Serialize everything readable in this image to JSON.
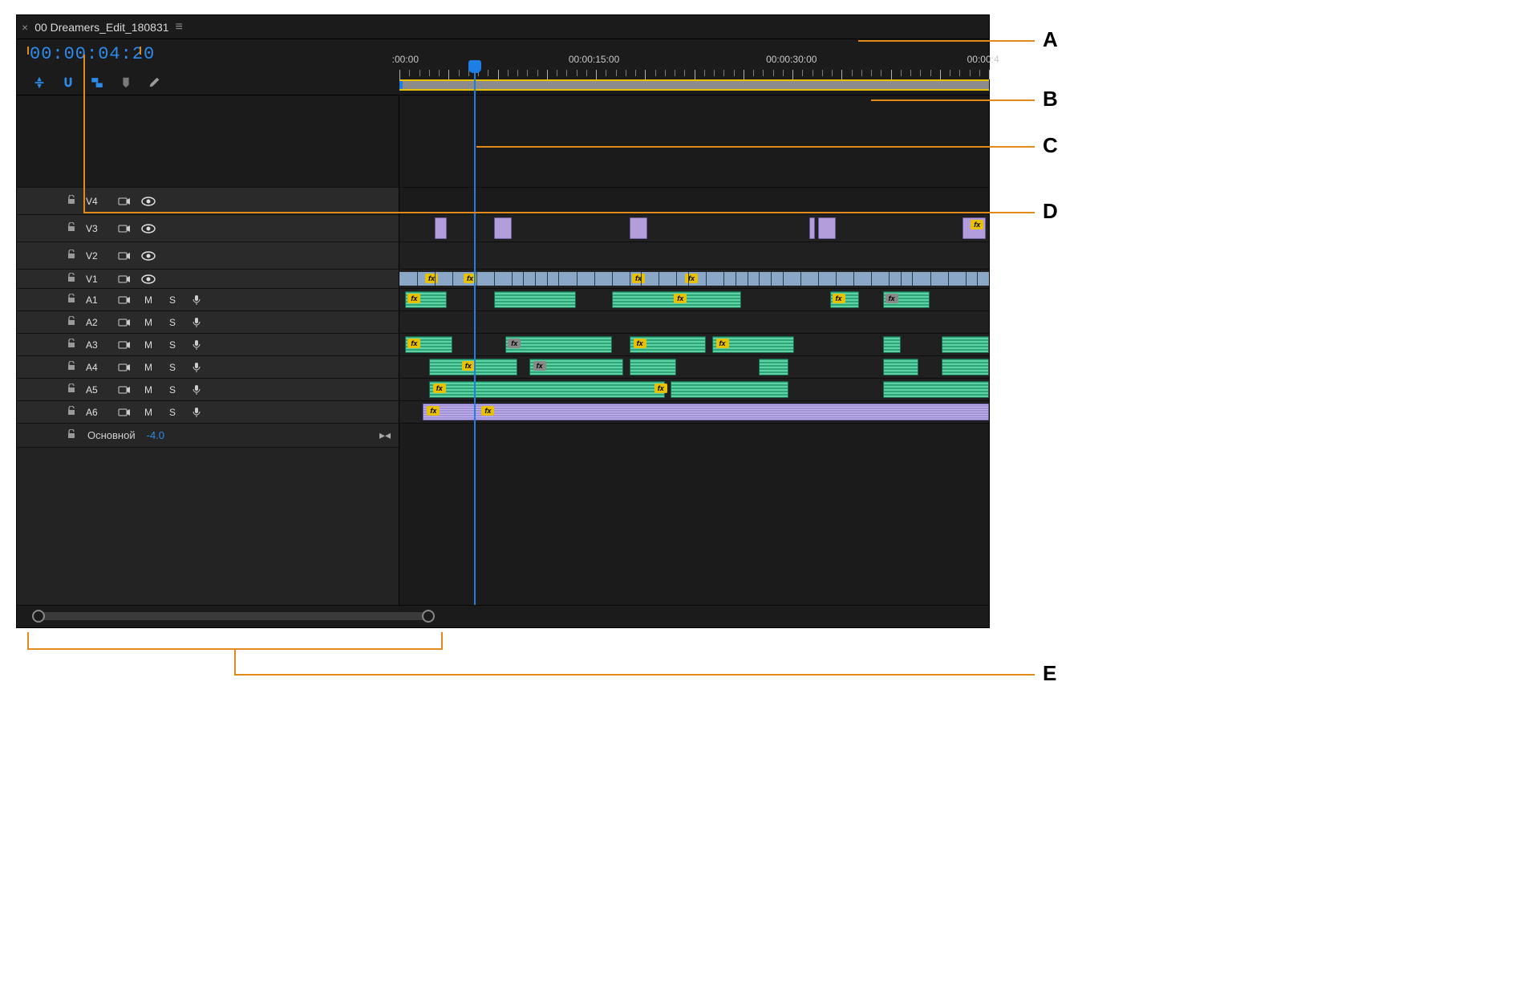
{
  "tab": {
    "title": "00 Dreamers_Edit_180831"
  },
  "timecode": "00:00:04:20",
  "ruler": {
    "labels": [
      ":00:00",
      "00:00:15:00",
      "00:00:30:00",
      "00:00:4"
    ],
    "label_positions_pct": [
      1.0,
      33.0,
      66.5,
      100.0
    ]
  },
  "tracks": {
    "video": [
      "V4",
      "V3",
      "V2",
      "V1"
    ],
    "audio": [
      "A1",
      "A2",
      "A3",
      "A4",
      "A5",
      "A6"
    ],
    "master_label": "Основной",
    "master_value": "-4.0",
    "mute": "M",
    "solo": "S"
  },
  "callouts": {
    "A": "A",
    "B": "B",
    "C": "C",
    "D": "D",
    "E": "E"
  },
  "icons": {
    "insert": "insert-overwrite-icon",
    "snap": "snap-icon",
    "linked": "linked-selection-icon",
    "marker": "marker-icon",
    "wrench": "settings-icon"
  },
  "fx_label": "fx"
}
